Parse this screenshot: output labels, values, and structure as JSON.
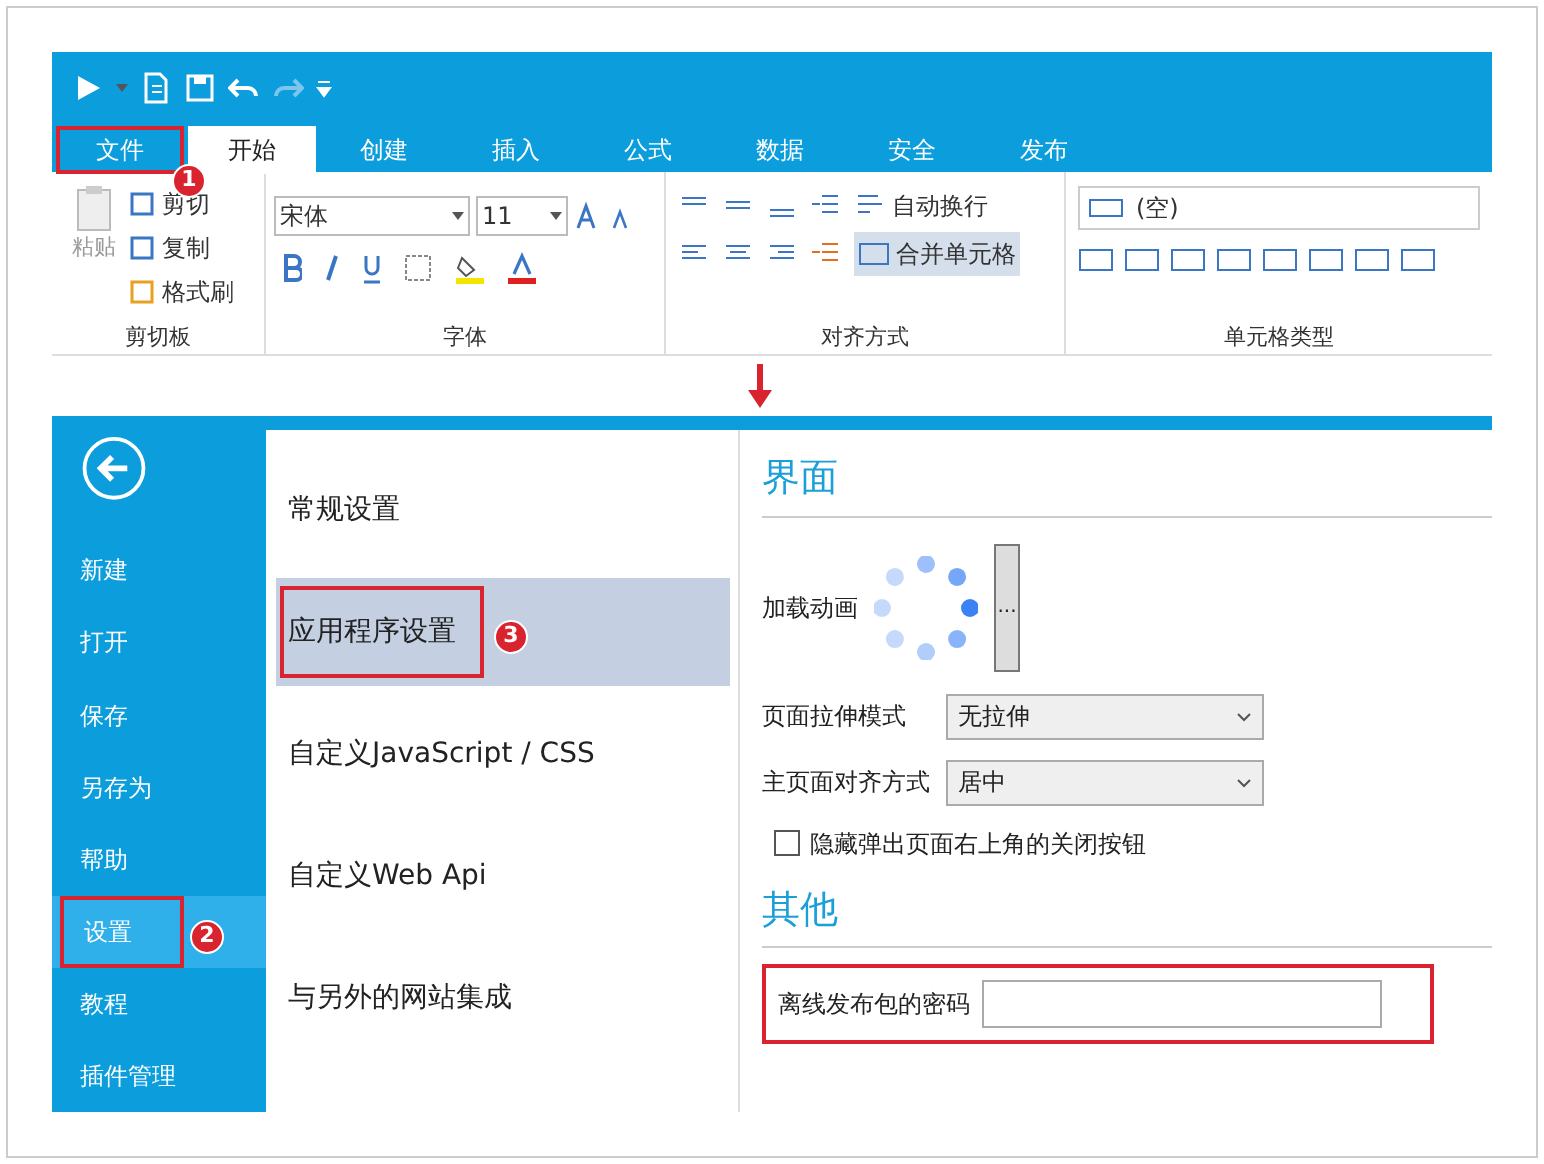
{
  "ribbon_tabs": [
    {
      "label": "文件",
      "selected": false,
      "highlighted": true,
      "callout": "1"
    },
    {
      "label": "开始",
      "selected": true,
      "highlighted": false
    },
    {
      "label": "创建",
      "selected": false,
      "highlighted": false
    },
    {
      "label": "插入",
      "selected": false,
      "highlighted": false
    },
    {
      "label": "公式",
      "selected": false,
      "highlighted": false
    },
    {
      "label": "数据",
      "selected": false,
      "highlighted": false
    },
    {
      "label": "安全",
      "selected": false,
      "highlighted": false
    },
    {
      "label": "发布",
      "selected": false,
      "highlighted": false
    }
  ],
  "clipboard": {
    "paste": "粘贴",
    "cut": "剪切",
    "copy": "复制",
    "format_painter": "格式刷",
    "label": "剪切板"
  },
  "font": {
    "family": "宋体",
    "size": "11",
    "label": "字体"
  },
  "alignment": {
    "wrap": "自动换行",
    "merge": "合并单元格",
    "merge_selected": true,
    "label": "对齐方式"
  },
  "cell_type": {
    "value": "(空)",
    "label": "单元格类型"
  },
  "backstage_nav": [
    {
      "label": "新建",
      "selected": false,
      "highlighted": false
    },
    {
      "label": "打开",
      "selected": false,
      "highlighted": false
    },
    {
      "label": "保存",
      "selected": false,
      "highlighted": false
    },
    {
      "label": "另存为",
      "selected": false,
      "highlighted": false
    },
    {
      "label": "帮助",
      "selected": false,
      "highlighted": false
    },
    {
      "label": "设置",
      "selected": true,
      "highlighted": true,
      "callout": "2"
    },
    {
      "label": "教程",
      "selected": false,
      "highlighted": false
    },
    {
      "label": "插件管理",
      "selected": false,
      "highlighted": false
    }
  ],
  "settings_categories": [
    {
      "label": "常规设置",
      "selected": false,
      "highlighted": false
    },
    {
      "label": "应用程序设置",
      "selected": true,
      "highlighted": true,
      "callout": "3"
    },
    {
      "label": "自定义JavaScript / CSS",
      "selected": false,
      "highlighted": false
    },
    {
      "label": "自定义Web Api",
      "selected": false,
      "highlighted": false
    },
    {
      "label": "与另外的网站集成",
      "selected": false,
      "highlighted": false
    }
  ],
  "sections": [
    {
      "title": "界面",
      "fields": [
        {
          "kind": "spinner",
          "label": "加载动画",
          "button": "..."
        },
        {
          "kind": "select",
          "label": "页面拉伸模式",
          "value": "无拉伸"
        },
        {
          "kind": "select",
          "label": "主页面对齐方式",
          "value": "居中"
        },
        {
          "kind": "checkbox",
          "label": "隐藏弹出页面右上角的关闭按钮",
          "checked": false
        }
      ]
    },
    {
      "title": "其他",
      "fields": [
        {
          "kind": "text",
          "label": "离线发布包的密码",
          "highlighted": true
        }
      ]
    }
  ]
}
